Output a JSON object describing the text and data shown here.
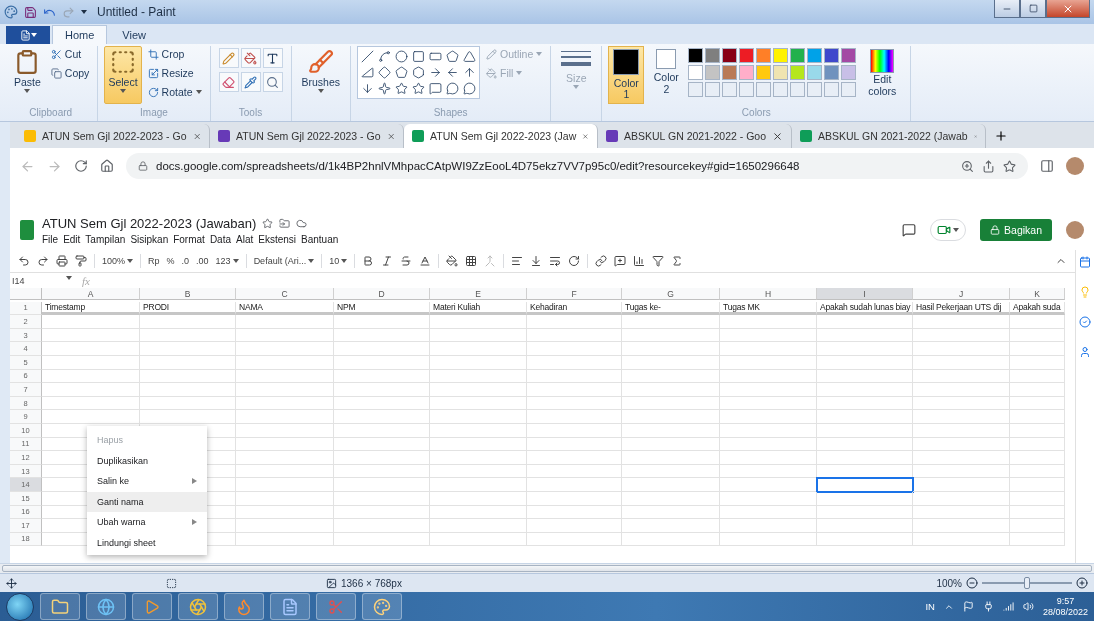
{
  "paint": {
    "title": "Untitled - Paint",
    "ribbon_tabs": [
      {
        "label": "Home",
        "selected": true
      },
      {
        "label": "View",
        "selected": false
      }
    ],
    "groups": {
      "clipboard": "Clipboard",
      "image": "Image",
      "tools": "Tools",
      "shapes": "Shapes",
      "colors": "Colors"
    },
    "paste": "Paste",
    "cut": "Cut",
    "copy": "Copy",
    "select": "Select",
    "crop": "Crop",
    "resize": "Resize",
    "rotate": "Rotate",
    "brushes": "Brushes",
    "outline": "Outline",
    "fill": "Fill",
    "size": "Size",
    "color_slots": [
      {
        "label": "Color",
        "number": "1",
        "color": "#000000",
        "selected": true
      },
      {
        "label": "Color",
        "number": "2",
        "color": "#ffffff",
        "selected": false
      }
    ],
    "palette": [
      {
        "color": "#000000"
      },
      {
        "color": "#7f7f7f"
      },
      {
        "color": "#880015"
      },
      {
        "color": "#ed1c24"
      },
      {
        "color": "#ff7f27"
      },
      {
        "color": "#fff200"
      },
      {
        "color": "#22b14c"
      },
      {
        "color": "#00a2e8"
      },
      {
        "color": "#3f48cc"
      },
      {
        "color": "#a349a4"
      },
      {
        "color": "#ffffff"
      },
      {
        "color": "#c3c3c3"
      },
      {
        "color": "#b97a57"
      },
      {
        "color": "#ffaec9"
      },
      {
        "color": "#ffc90e"
      },
      {
        "color": "#efe4b0"
      },
      {
        "color": "#b5e61d"
      },
      {
        "color": "#99d9ea"
      },
      {
        "color": "#7092be"
      },
      {
        "color": "#c8bfe7"
      }
    ],
    "edit_colors": "Edit colors",
    "status": {
      "dimensions": "1366 × 768px",
      "zoom": "100%",
      "zoom_slider": {
        "level": 0.5
      }
    }
  },
  "browser": {
    "tabs": [
      {
        "kind": "drive",
        "title": "ATUN Sem Gjl 2022-2023 - Go",
        "selected": false
      },
      {
        "kind": "forms",
        "title": "ATUN Sem Gjl 2022-2023 - Go",
        "selected": false
      },
      {
        "kind": "sheets",
        "title": "ATUN Sem Gjl 2022-2023 (Jaw",
        "selected": true
      },
      {
        "kind": "forms",
        "title": "ABSKUL GN 2021-2022 - Goo",
        "selected": false
      },
      {
        "kind": "sheets",
        "title": "ABSKUL GN 2021-2022 (Jawab",
        "selected": false
      }
    ],
    "url": "docs.google.com/spreadsheets/d/1k4BP2hnlVMhpacCAtpWI9ZzEooL4D75ekz7VV7p95c0/edit?resourcekey#gid=1650296648"
  },
  "sheet": {
    "title": "ATUN Sem Gjl 2022-2023 (Jawaban)",
    "menu": [
      "File",
      "Edit",
      "Tampilan",
      "Sisipkan",
      "Format",
      "Data",
      "Alat",
      "Ekstensi",
      "Bantuan"
    ],
    "share": "Bagikan",
    "toolbar": {
      "zoom": "100%",
      "currency": "Rp",
      "percent": "%",
      "decimal_less": ".0",
      "decimal_more": ".00",
      "number_format": "123",
      "font": "Default (Ari...",
      "font_size": "10"
    },
    "name_box": "I14",
    "fx": "fx",
    "columns": [
      {
        "letter": "A",
        "selected": false
      },
      {
        "letter": "B",
        "selected": false
      },
      {
        "letter": "C",
        "selected": false
      },
      {
        "letter": "D",
        "selected": false
      },
      {
        "letter": "E",
        "selected": false
      },
      {
        "letter": "F",
        "selected": false
      },
      {
        "letter": "G",
        "selected": false
      },
      {
        "letter": "H",
        "selected": false
      },
      {
        "letter": "I",
        "selected": true
      },
      {
        "letter": "J",
        "selected": false
      },
      {
        "letter": "K",
        "selected": false
      }
    ],
    "header_cells": [
      "Timestamp",
      "PRODI",
      "NAMA",
      "NPM",
      "Materi Kuliah",
      "Kehadiran",
      "Tugas ke-",
      "Tugas MK",
      "Apakah sudah lunas biay",
      "Hasil  Pekerjaan  UTS dij",
      "Apakah suda"
    ],
    "rows": [
      {
        "number": "1",
        "selected": false
      },
      {
        "number": "2",
        "selected": false
      },
      {
        "number": "3",
        "selected": false
      },
      {
        "number": "4",
        "selected": false
      },
      {
        "number": "5",
        "selected": false
      },
      {
        "number": "6",
        "selected": false
      },
      {
        "number": "7",
        "selected": false
      },
      {
        "number": "8",
        "selected": false
      },
      {
        "number": "9",
        "selected": false
      },
      {
        "number": "10",
        "selected": false
      },
      {
        "number": "11",
        "selected": false
      },
      {
        "number": "12",
        "selected": false
      },
      {
        "number": "13",
        "selected": false
      },
      {
        "number": "14",
        "selected": true
      },
      {
        "number": "15",
        "selected": false
      },
      {
        "number": "16",
        "selected": false
      },
      {
        "number": "17",
        "selected": false
      },
      {
        "number": "18",
        "selected": false
      }
    ],
    "context_menu": [
      {
        "label": "Hapus",
        "disabled": true,
        "submenu": false,
        "selected": false
      },
      {
        "label": "Duplikasikan",
        "disabled": false,
        "submenu": false,
        "selected": false
      },
      {
        "label": "Salin ke",
        "disabled": false,
        "submenu": true,
        "selected": false
      },
      {
        "label": "Ganti nama",
        "disabled": false,
        "submenu": false,
        "selected": true
      },
      {
        "label": "Ubah warna",
        "disabled": false,
        "submenu": true,
        "selected": false
      },
      {
        "label": "Lindungi sheet",
        "disabled": false,
        "submenu": false,
        "selected": false
      }
    ]
  },
  "taskbar": {
    "language": "IN",
    "time": "9:57",
    "date": "28/08/2022"
  }
}
